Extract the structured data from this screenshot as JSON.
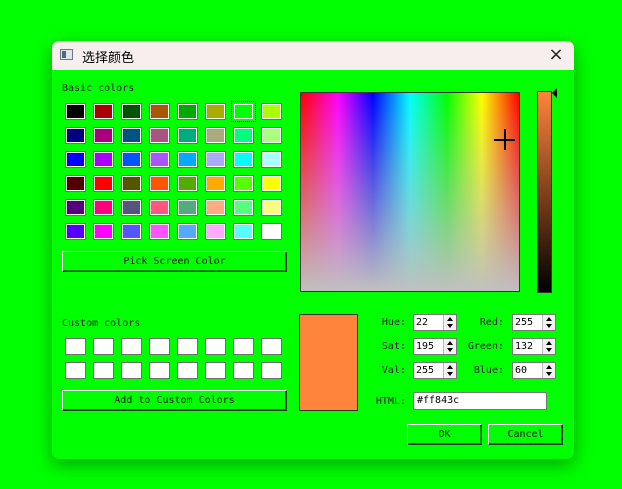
{
  "dialog": {
    "title": "选择颜色",
    "close_icon": "×"
  },
  "basic_colors": {
    "label": "Basic colors",
    "rows": [
      [
        "#000000",
        "#aa0000",
        "#005500",
        "#aa5500",
        "#00aa00",
        "#aaaa00",
        "#00ff00",
        "#aaff00"
      ],
      [
        "#00007f",
        "#aa007f",
        "#00557f",
        "#aa557f",
        "#00aa7f",
        "#aaaa7f",
        "#00ff7f",
        "#aaff7f"
      ],
      [
        "#0000ff",
        "#aa00ff",
        "#0055ff",
        "#aa55ff",
        "#00aaff",
        "#aaaaff",
        "#00ffff",
        "#aaffff"
      ],
      [
        "#550000",
        "#ff0000",
        "#555500",
        "#ff5500",
        "#55aa00",
        "#ffaa00",
        "#55ff00",
        "#ffff00"
      ],
      [
        "#55007f",
        "#ff007f",
        "#55557f",
        "#ff557f",
        "#55aa7f",
        "#ffaa7f",
        "#55ff7f",
        "#ffff7f"
      ],
      [
        "#5500ff",
        "#ff00ff",
        "#5555ff",
        "#ff55ff",
        "#55aaff",
        "#ffaaff",
        "#55ffff",
        "#ffffff"
      ]
    ],
    "selected_index": 6
  },
  "buttons": {
    "pick_screen": "Pick Screen Color",
    "add_custom": "Add to Custom Colors",
    "ok": "OK",
    "cancel": "Cancel"
  },
  "custom_colors": {
    "label": "Custom colors",
    "rows": [
      [
        "#ffffff",
        "#ffffff",
        "#ffffff",
        "#ffffff",
        "#ffffff",
        "#ffffff",
        "#ffffff",
        "#ffffff"
      ],
      [
        "#ffffff",
        "#ffffff",
        "#ffffff",
        "#ffffff",
        "#ffffff",
        "#ffffff",
        "#ffffff",
        "#ffffff"
      ]
    ]
  },
  "current_color": "#ff843c",
  "fields": {
    "hue": {
      "label": "Hue:",
      "value": "22"
    },
    "sat": {
      "label": "Sat:",
      "value": "195"
    },
    "val": {
      "label": "Val:",
      "value": "255"
    },
    "red": {
      "label": "Red:",
      "value": "255"
    },
    "green": {
      "label": "Green:",
      "value": "132"
    },
    "blue": {
      "label": "Blue:",
      "value": "60"
    },
    "html": {
      "label": "HTML:",
      "value": "#ff843c"
    }
  }
}
